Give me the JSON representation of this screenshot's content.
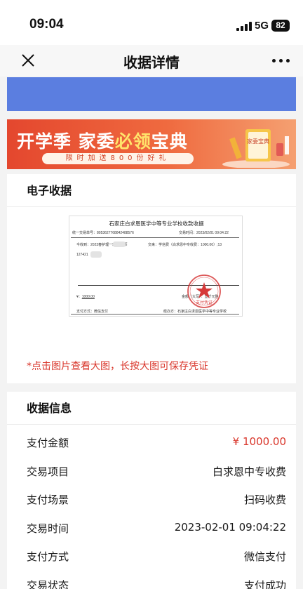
{
  "status_bar": {
    "time": "09:04",
    "network": "5G",
    "battery": "82"
  },
  "nav": {
    "title": "收据详情"
  },
  "banner": {
    "title_part1": "开学季 家委",
    "title_highlight": "必领",
    "title_part2": "宝典",
    "subtitle": "限时加送800份好礼",
    "book_text": "家委宝典"
  },
  "receipt_section": {
    "header": "电子收据",
    "document": {
      "title": "石家庄白求恩医学中等专业学校收款收据",
      "serial_label": "统一交易单号：",
      "serial": "8053627768842488576",
      "time_label": "交易时间：",
      "time": "2023/02/01 09:04:22",
      "payer_label": "今收到",
      "payer": "2023春护理一班 刘老师",
      "item_label": "交来",
      "item": "学信费（白求恩中专收费：1000.00）;13",
      "phone_partial": "127421",
      "amount_label": "¥：",
      "amount": "1000.00",
      "amount_words_label": "金额（大写）：",
      "amount_words": "壹仟元整",
      "method_label": "支付方式：",
      "method": "微信支付",
      "receiver_label": "经办方：",
      "receiver": "石家庄白求恩医学中等专业学校",
      "stamp_text": "支付凭证"
    },
    "tip": "*点击图片查看大图，长按大图可保存凭证"
  },
  "info_section": {
    "header": "收据信息",
    "rows": [
      {
        "label": "支付金额",
        "value": "¥ 1000.00"
      },
      {
        "label": "交易项目",
        "value": "白求恩中专收费"
      },
      {
        "label": "支付场景",
        "value": "扫码收费"
      },
      {
        "label": "交易时间",
        "value": "2023-02-01 09:04:22"
      },
      {
        "label": "支付方式",
        "value": "微信支付"
      },
      {
        "label": "交易状态",
        "value": "支付成功"
      }
    ]
  },
  "colors": {
    "accent_red": "#d9362b",
    "blue_band": "#5b7ee0",
    "banner_orange": "#e4472e"
  }
}
